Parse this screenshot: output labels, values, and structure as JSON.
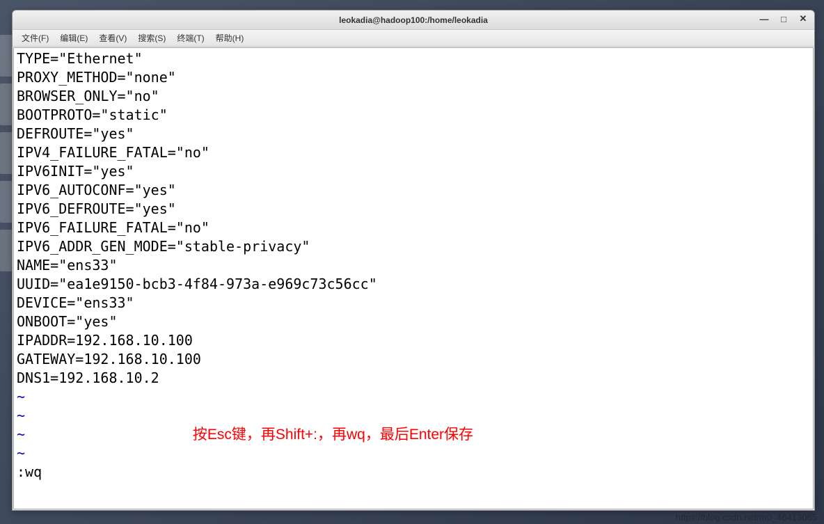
{
  "window": {
    "title": "leokadia@hadoop100:/home/leokadia"
  },
  "menubar": {
    "file": "文件(F)",
    "edit": "编辑(E)",
    "view": "查看(V)",
    "search": "搜索(S)",
    "terminal": "终端(T)",
    "help": "帮助(H)"
  },
  "content": {
    "lines": [
      "TYPE=\"Ethernet\"",
      "PROXY_METHOD=\"none\"",
      "BROWSER_ONLY=\"no\"",
      "BOOTPROTO=\"static\"",
      "DEFROUTE=\"yes\"",
      "IPV4_FAILURE_FATAL=\"no\"",
      "IPV6INIT=\"yes\"",
      "IPV6_AUTOCONF=\"yes\"",
      "IPV6_DEFROUTE=\"yes\"",
      "IPV6_FAILURE_FATAL=\"no\"",
      "IPV6_ADDR_GEN_MODE=\"stable-privacy\"",
      "NAME=\"ens33\"",
      "UUID=\"ea1e9150-bcb3-4f84-973a-e969c73c56cc\"",
      "DEVICE=\"ens33\"",
      "ONBOOT=\"yes\"",
      "",
      "IPADDR=192.168.10.100",
      "GATEWAY=192.168.10.100",
      "DNS1=192.168.10.2"
    ],
    "tilde": "~",
    "instruction": "按Esc键，再Shift+:，再wq，最后Enter保存",
    "command": ":wq"
  },
  "watermark": "https://blog.csdn.net/m0_46413065"
}
